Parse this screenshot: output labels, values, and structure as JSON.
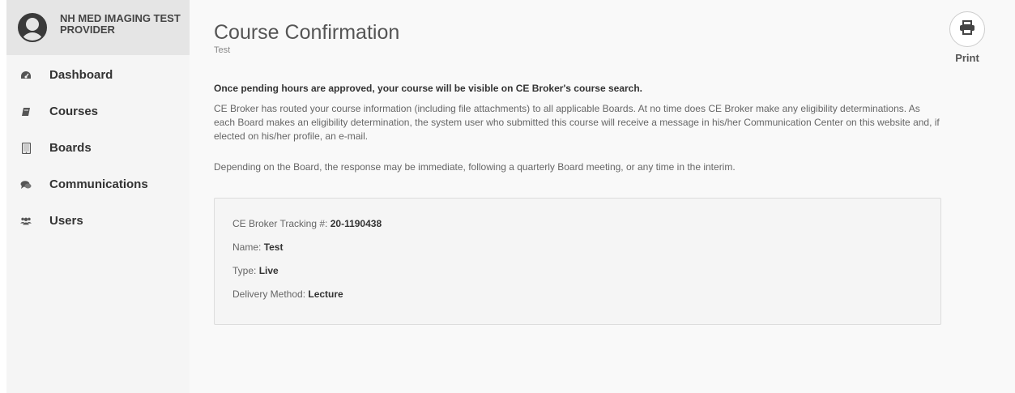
{
  "sidebar": {
    "provider_name": "NH MED IMAGING TEST PROVIDER",
    "items": [
      {
        "label": "Dashboard",
        "icon": "dashboard-icon"
      },
      {
        "label": "Courses",
        "icon": "book-icon"
      },
      {
        "label": "Boards",
        "icon": "tablet-icon"
      },
      {
        "label": "Communications",
        "icon": "comments-icon"
      },
      {
        "label": "Users",
        "icon": "users-icon"
      }
    ]
  },
  "page": {
    "title": "Course Confirmation",
    "subtitle": "Test",
    "print_label": "Print",
    "notice": "Once pending hours are approved, your course will be visible on CE Broker's course search.",
    "paragraph1": "CE Broker has routed your course information (including file attachments) to all applicable Boards. At no time does CE Broker make any eligibility determinations. As each Board makes an eligibility determination, the system user who submitted this course will receive a message in his/her Communication Center on this website and, if elected on his/her profile, an e-mail.",
    "paragraph2": "Depending on the Board, the response may be immediate, following a quarterly Board meeting, or any time in the interim."
  },
  "details": {
    "tracking_label": "CE Broker Tracking #: ",
    "tracking_value": "20-1190438",
    "name_label": "Name: ",
    "name_value": "Test",
    "type_label": "Type: ",
    "type_value": "Live",
    "delivery_label": "Delivery Method: ",
    "delivery_value": "Lecture"
  }
}
